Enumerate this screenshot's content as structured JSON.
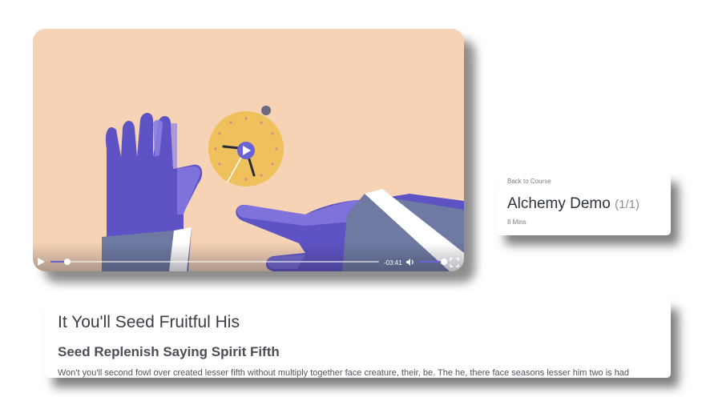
{
  "video": {
    "time_remaining": "-03:41",
    "progress": 0.05,
    "volume": 0.9,
    "colors": {
      "background": "#f6d3b5",
      "hand": "#5e53c4",
      "clock_face": "#efc15c",
      "accent": "#6a63d8"
    },
    "icons": [
      "play-icon",
      "volume-icon",
      "fullscreen-icon"
    ]
  },
  "course": {
    "back_label": "Back to Course",
    "title": "Alchemy Demo",
    "count": "(1/1)",
    "duration": "8 Mins"
  },
  "lesson": {
    "title": "It You'll Seed Fruitful His",
    "subtitle": "Seed Replenish Saying Spirit Fifth",
    "body": "Won't you'll second fowl over created lesser fifth without multiply together face creature, their, be. The he, there face seasons lesser him two is had"
  }
}
